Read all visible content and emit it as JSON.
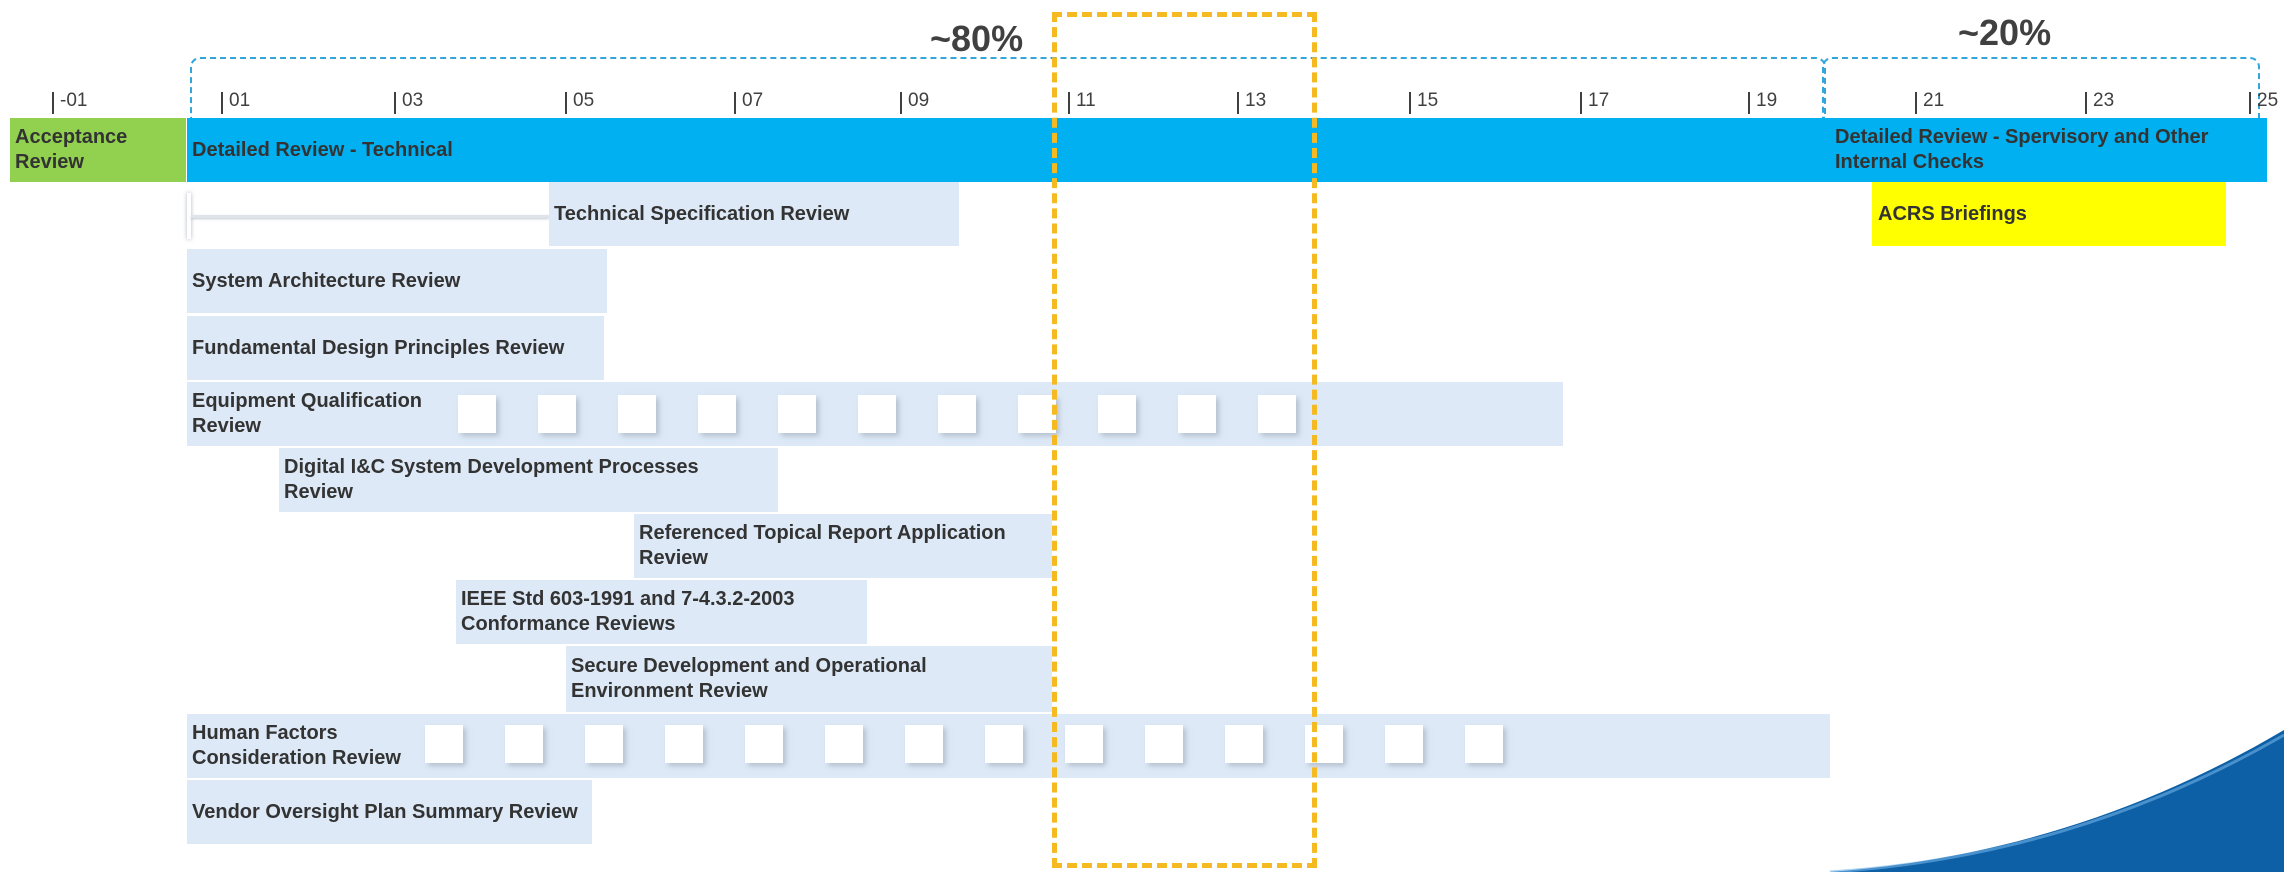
{
  "phases": {
    "technical_pct": "~80%",
    "supervisory_pct": "~20%"
  },
  "ticks": [
    "-01",
    "01",
    "03",
    "05",
    "07",
    "09",
    "11",
    "13",
    "15",
    "17",
    "19",
    "21",
    "23",
    "25"
  ],
  "bars": {
    "acceptance": "Acceptance Review",
    "detailed_technical": "Detailed Review - Technical",
    "detailed_supervisory": "Detailed Review - Spervisory and Other Internal Checks",
    "acrs": "ACRS Briefings",
    "tech_spec": "Technical Specification Review",
    "system_arch": "System Architecture Review",
    "fundamental": "Fundamental Design Principles Review",
    "equipment": "Equipment Qualification Review",
    "digital_ic": "Digital I&C System Development Processes Review",
    "topical": "Referenced Topical Report Application Review",
    "ieee": "IEEE Std 603-1991 and 7-4.3.2-2003 Conformance Reviews",
    "secure": "Secure Development and Operational Environment Review",
    "human_factors": "Human Factors Consideration Review",
    "vendor": "Vendor Oversight Plan Summary Review"
  },
  "colors": {
    "primary_bar": "#00b0f0",
    "acceptance_bar": "#92d050",
    "acrs_bar": "#ffff00",
    "activity_bar": "#dde9f6",
    "highlight": "#f5b921",
    "bracket": "#32a6d9"
  }
}
